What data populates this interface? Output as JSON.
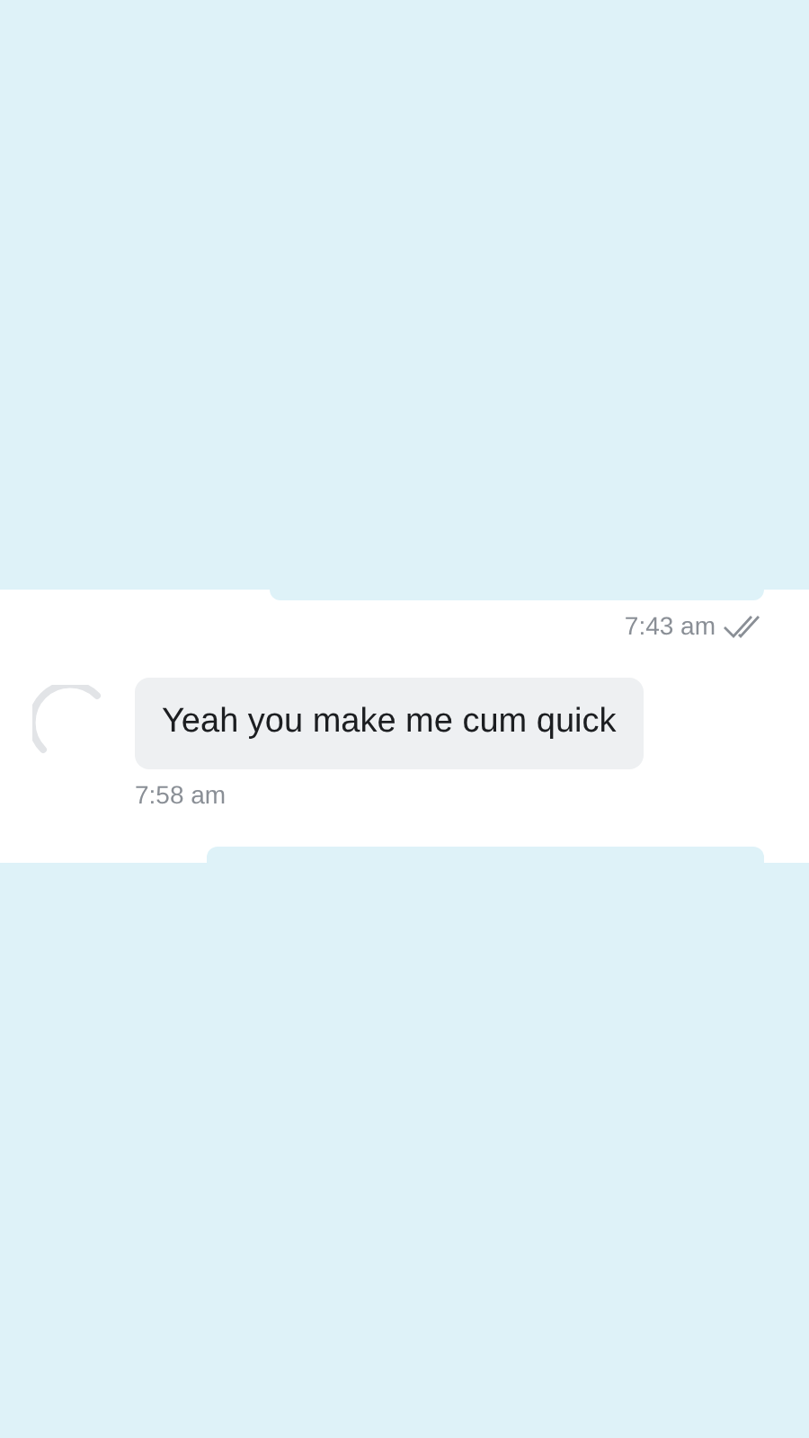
{
  "messages": [
    {
      "kind": "outgoing_meta",
      "time": "7:43 am",
      "read": true
    },
    {
      "kind": "incoming",
      "text": "Yeah you make me cum quick",
      "time": "7:58 am"
    }
  ]
}
